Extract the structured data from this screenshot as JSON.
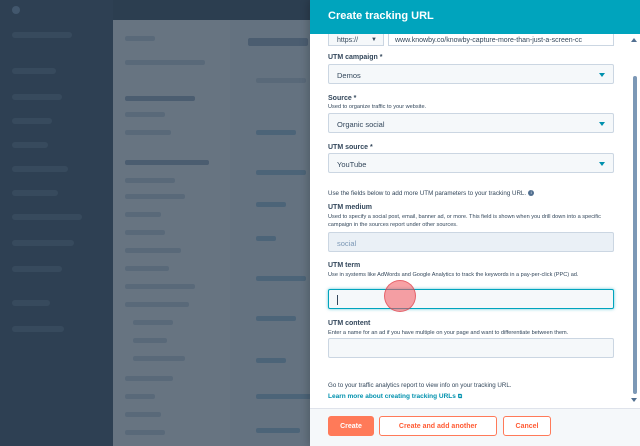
{
  "panel": {
    "title": "Create tracking URL",
    "url_prefix": "https://",
    "url_value": "www.knowby.co/knowby-capture-more-than-just-a-screen-cc"
  },
  "fields": {
    "utm_campaign": {
      "label": "UTM campaign *",
      "value": "Demos"
    },
    "source": {
      "label": "Source *",
      "help": "Used to organize traffic to your website.",
      "value": "Organic social"
    },
    "utm_source": {
      "label": "UTM source *",
      "value": "YouTube"
    },
    "more_params_info": "Use the fields below to add more UTM parameters to your tracking URL.",
    "utm_medium": {
      "label": "UTM medium",
      "help": "Used to specify a social post, email, banner ad, or more. This field is shown when you drill down into a specific campaign in the sources report under other sources.",
      "value": "social"
    },
    "utm_term": {
      "label": "UTM term",
      "help": "Use in systems like AdWords and Google Analytics to track the keywords in a pay-per-click (PPC) ad.",
      "value": ""
    },
    "utm_content": {
      "label": "UTM content",
      "help": "Enter a name for an ad if you have multiple on your page and want to differentiate between them.",
      "value": ""
    }
  },
  "footer_note": {
    "text": "Go to your traffic analytics report to view info on your tracking URL.",
    "link": "Learn more about creating tracking URLs"
  },
  "buttons": {
    "create": "Create",
    "create_another": "Create and add another",
    "cancel": "Cancel"
  },
  "colors": {
    "header": "#00a4bd",
    "primary": "#ff7a59",
    "link": "#0091ae",
    "text": "#33475b"
  },
  "icons": {
    "info": "info-icon",
    "external_link": "external-link-icon",
    "dropdown": "chevron-down-icon"
  }
}
